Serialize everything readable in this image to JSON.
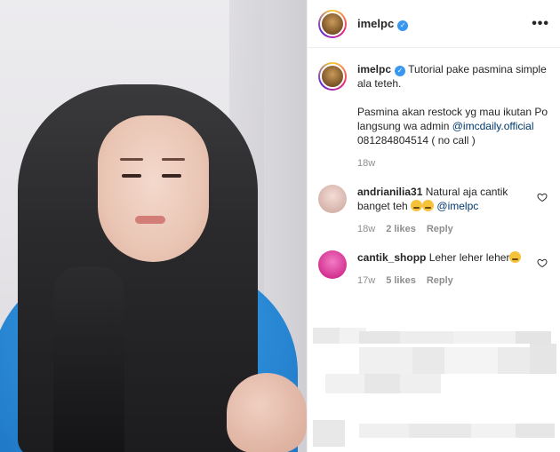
{
  "post": {
    "username": "imelpc",
    "verified_mark": "✓",
    "more_label": "•••"
  },
  "caption": {
    "username": "imelpc",
    "line1": "Tutorial pake pasmina simple ala teteh.",
    "line2": "Pasmina akan restock yg mau ikutan Po langsung wa admin",
    "mention": "@imcdaily.official",
    "line3": "081284804514 ( no call )",
    "time": "18w"
  },
  "comments": [
    {
      "username": "andrianilia31",
      "text": "Natural aja cantik banget teh",
      "mention": "@imelpc",
      "time": "18w",
      "likes": "2 likes",
      "reply": "Reply",
      "avatar_color": "#e8c9c3"
    },
    {
      "username": "cantik_shopp",
      "text": "Leher leher leher",
      "time": "17w",
      "likes": "5 likes",
      "reply": "Reply",
      "avatar_color": "#e0259b"
    }
  ],
  "icons": {
    "heart": "heart-icon",
    "verified": "verified-badge-icon",
    "more": "more-options-icon"
  },
  "colors": {
    "verified_blue": "#3897f0",
    "link": "#00376b",
    "muted": "#8e8e8e"
  }
}
